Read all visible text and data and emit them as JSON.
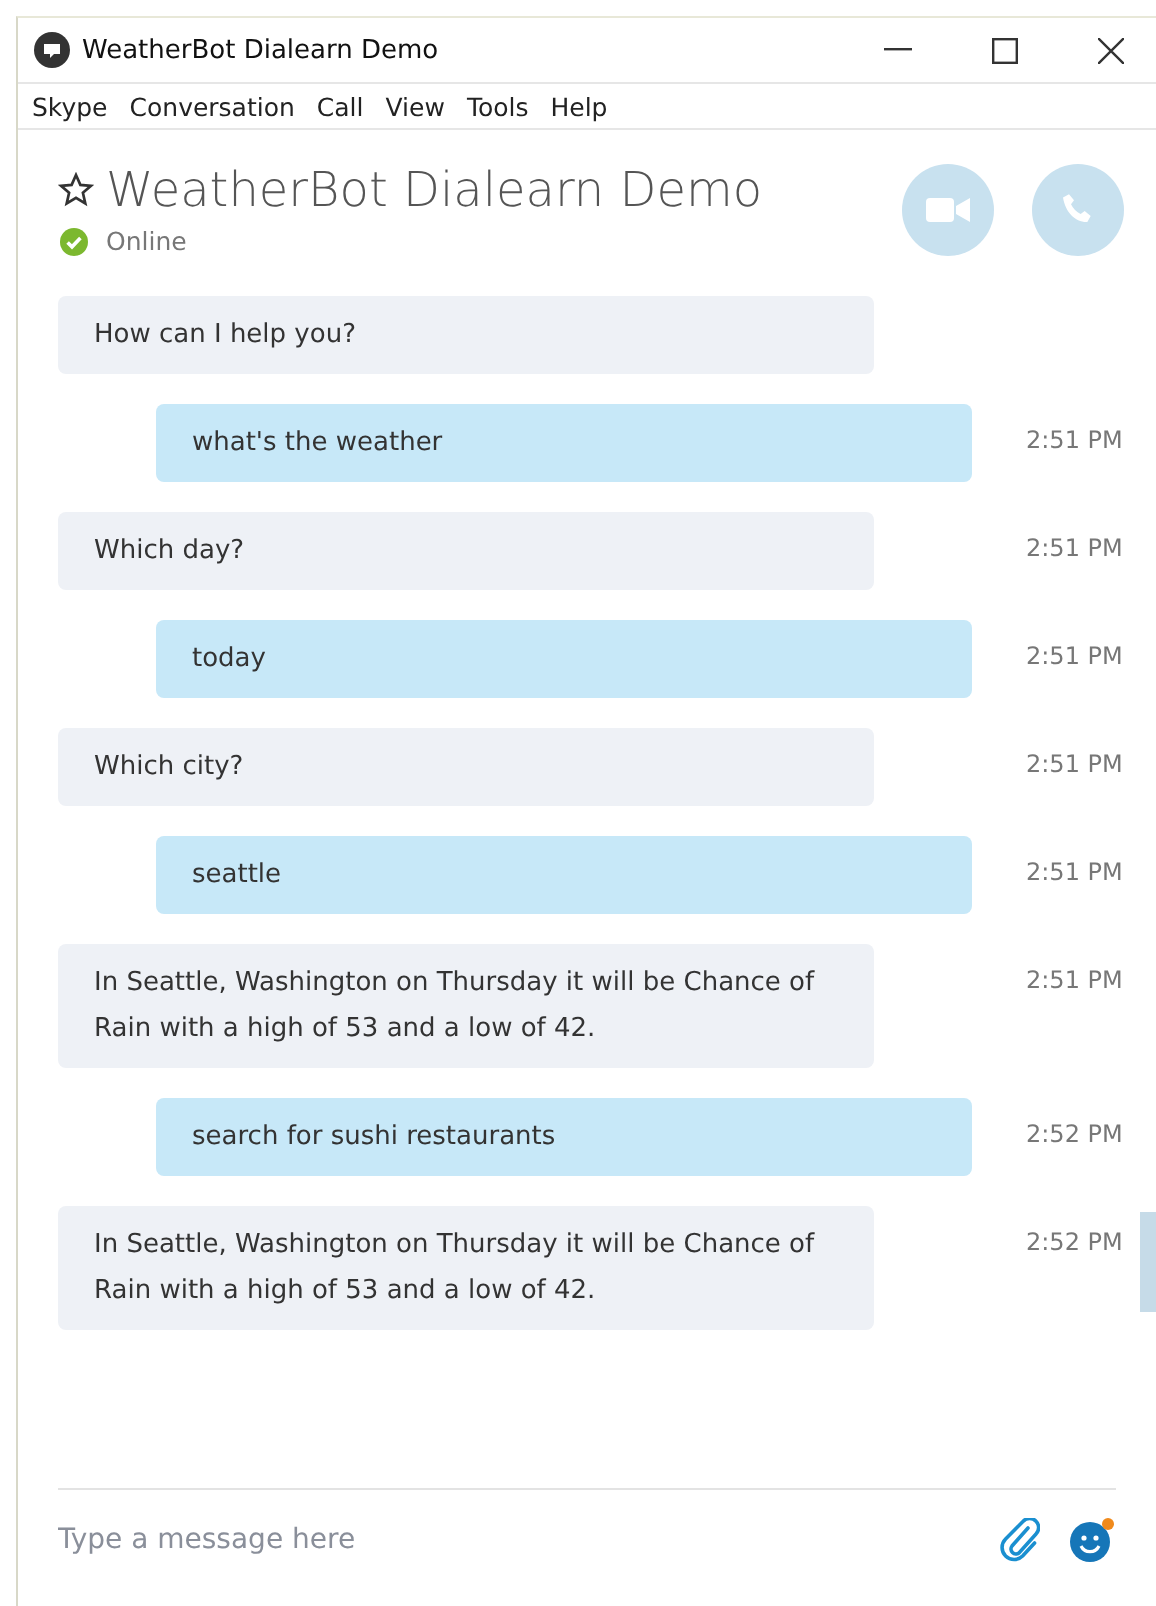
{
  "window": {
    "title": "WeatherBot Dialearn Demo"
  },
  "menu": [
    "Skype",
    "Conversation",
    "Call",
    "View",
    "Tools",
    "Help"
  ],
  "header": {
    "name": "WeatherBot Dialearn Demo",
    "status": "Online",
    "favorite": false
  },
  "messages": [
    {
      "kind": "bot",
      "text": "How can I help you?"
    },
    {
      "kind": "user",
      "text": "what's the weather",
      "time": "2:51 PM"
    },
    {
      "kind": "bot",
      "text": "Which day?",
      "time": "2:51 PM"
    },
    {
      "kind": "user",
      "text": "today",
      "time": "2:51 PM"
    },
    {
      "kind": "bot",
      "text": "Which city?",
      "time": "2:51 PM"
    },
    {
      "kind": "user",
      "text": "seattle",
      "time": "2:51 PM"
    },
    {
      "kind": "bot",
      "text": "In Seattle, Washington on Thursday it will be Chance of Rain with a high of 53 and a low of 42.",
      "time": "2:51 PM"
    },
    {
      "kind": "user",
      "text": "search for sushi restaurants",
      "time": "2:52 PM"
    },
    {
      "kind": "bot",
      "text": "In Seattle, Washington on Thursday it will be Chance of Rain with a high of 53 and a low of 42.",
      "time": "2:52 PM"
    }
  ],
  "composer": {
    "placeholder": "Type a message here"
  }
}
